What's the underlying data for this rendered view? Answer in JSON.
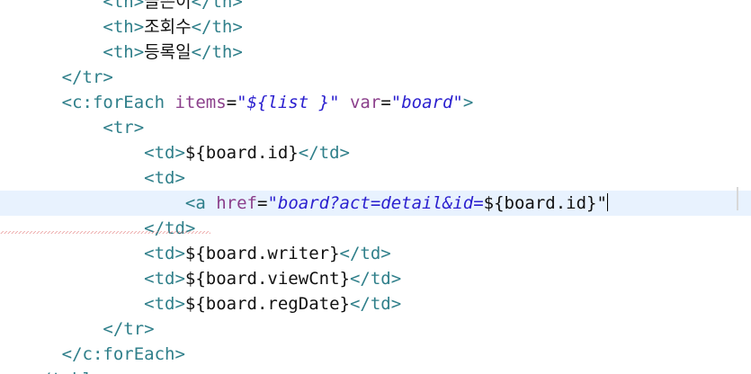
{
  "editor": {
    "lines": [
      {
        "indent": "          ",
        "segs": [
          [
            "t",
            "<th>"
          ],
          [
            "k",
            "글쓴이"
          ],
          [
            "t",
            "</th>"
          ]
        ]
      },
      {
        "indent": "          ",
        "segs": [
          [
            "t",
            "<th>"
          ],
          [
            "k",
            "조회수"
          ],
          [
            "t",
            "</th>"
          ]
        ]
      },
      {
        "indent": "          ",
        "segs": [
          [
            "t",
            "<th>"
          ],
          [
            "k",
            "등록일"
          ],
          [
            "t",
            "</th>"
          ]
        ]
      },
      {
        "indent": "      ",
        "segs": [
          [
            "t",
            "</tr>"
          ]
        ]
      },
      {
        "indent": "      ",
        "segs": [
          [
            "t",
            "<c:forEach "
          ],
          [
            "a",
            "items"
          ],
          [
            "k",
            "="
          ],
          [
            "s",
            "\"${list }\""
          ],
          [
            "k",
            " "
          ],
          [
            "a",
            "var"
          ],
          [
            "k",
            "="
          ],
          [
            "s",
            "\"board\""
          ],
          [
            "t",
            ">"
          ]
        ]
      },
      {
        "indent": "          ",
        "segs": [
          [
            "t",
            "<tr>"
          ]
        ]
      },
      {
        "indent": "              ",
        "segs": [
          [
            "t",
            "<td>"
          ],
          [
            "k",
            "${board.id}"
          ],
          [
            "t",
            "</td>"
          ]
        ]
      },
      {
        "indent": "              ",
        "segs": [
          [
            "t",
            "<td>"
          ]
        ]
      },
      {
        "indent": "                  ",
        "segs": [
          [
            "t",
            "<a "
          ],
          [
            "a",
            "href"
          ],
          [
            "k",
            "="
          ],
          [
            "s",
            "\"board?act=detail&id="
          ],
          [
            "k",
            "${board.id}\""
          ]
        ],
        "current": true
      },
      {
        "indent": "              ",
        "segs": [
          [
            "t",
            "</td>"
          ]
        ]
      },
      {
        "indent": "              ",
        "segs": [
          [
            "t",
            "<td>"
          ],
          [
            "k",
            "${board.writer}"
          ],
          [
            "t",
            "</td>"
          ]
        ]
      },
      {
        "indent": "              ",
        "segs": [
          [
            "t",
            "<td>"
          ],
          [
            "k",
            "${board.viewCnt}"
          ],
          [
            "t",
            "</td>"
          ]
        ]
      },
      {
        "indent": "              ",
        "segs": [
          [
            "t",
            "<td>"
          ],
          [
            "k",
            "${board.regDate}"
          ],
          [
            "t",
            "</td>"
          ]
        ]
      },
      {
        "indent": "          ",
        "segs": [
          [
            "t",
            "</tr>"
          ]
        ]
      },
      {
        "indent": "      ",
        "segs": [
          [
            "t",
            "</c:forEach>"
          ]
        ]
      },
      {
        "indent": "   ",
        "segs": [
          [
            "t",
            "</table>"
          ]
        ]
      }
    ]
  }
}
